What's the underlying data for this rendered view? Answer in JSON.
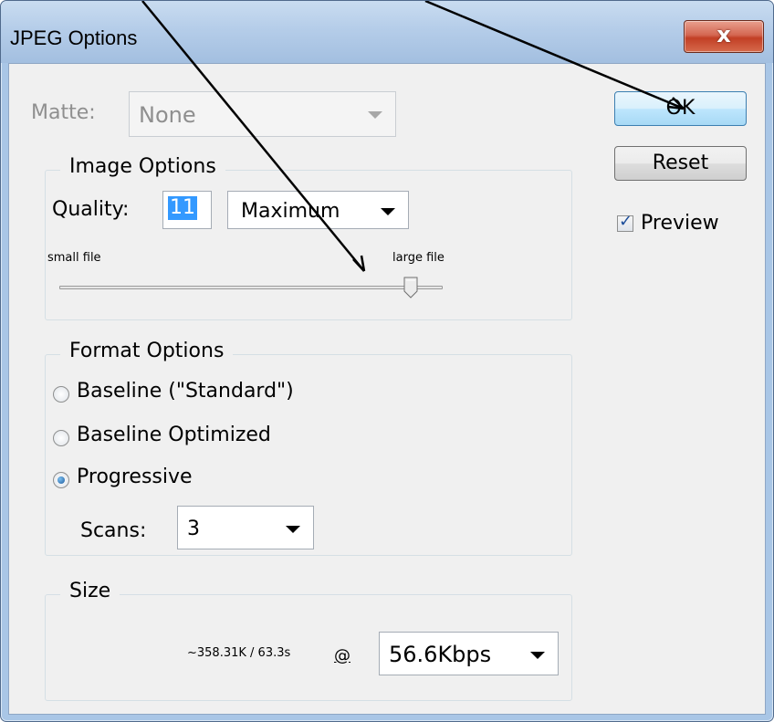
{
  "window": {
    "title": "JPEG Options",
    "close_glyph": "x"
  },
  "matte": {
    "label": "Matte:",
    "value": "None",
    "enabled": false
  },
  "image_options": {
    "legend": "Image Options",
    "quality_label": "Quality:",
    "quality_value": "11",
    "quality_preset": "Maximum",
    "slider_left_label": "small file",
    "slider_right_label": "large file",
    "quality_level": 0.917
  },
  "format_options": {
    "legend": "Format Options",
    "options": [
      {
        "label": "Baseline (\"Standard\")",
        "checked": false
      },
      {
        "label": "Baseline Optimized",
        "checked": false
      },
      {
        "label": "Progressive",
        "checked": true
      }
    ],
    "scans_label": "Scans:",
    "scans_value": "3"
  },
  "size": {
    "legend": "Size",
    "estimate": "~358.31K / 63.3s",
    "at_label": "@",
    "speed_value": "56.6Kbps"
  },
  "buttons": {
    "ok": "OK",
    "reset": "Reset"
  },
  "preview": {
    "label": "Preview",
    "checked": true
  },
  "colors": {
    "selection": "#3399ff",
    "frame": "#a9c6e6",
    "close_button": "#c94b32",
    "default_button": "#bee6fd",
    "annotation_arrows": "#000000"
  }
}
